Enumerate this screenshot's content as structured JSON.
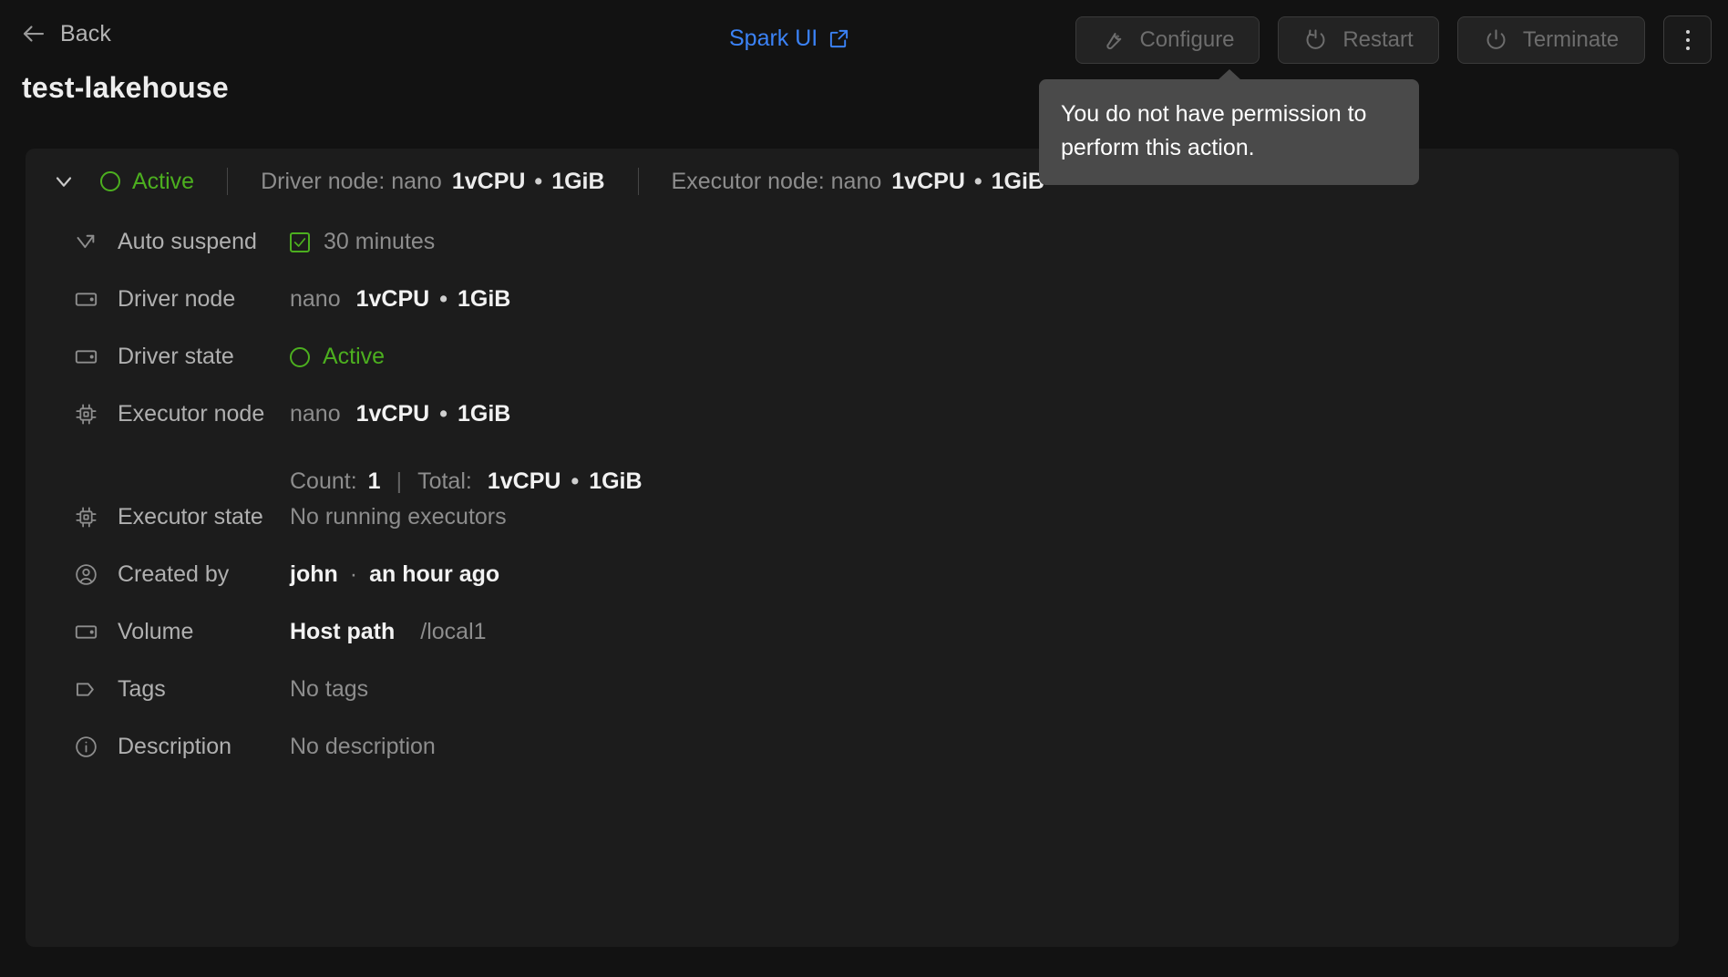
{
  "topbar": {
    "back_label": "Back",
    "back_icon": "arrow-left-icon",
    "spark_link_label": "Spark UI",
    "spark_link_icon": "external-link-icon",
    "buttons": [
      {
        "label": "Configure",
        "icon": "wrench-icon",
        "disabled": true
      },
      {
        "label": "Restart",
        "icon": "restart-power-icon",
        "disabled": true
      },
      {
        "label": "Terminate",
        "icon": "power-icon",
        "disabled": true
      }
    ],
    "kebab_icon": "more-vertical-icon"
  },
  "page_title": "test-lakehouse",
  "tooltip": {
    "text": "You do not have permission to perform this action."
  },
  "summary": {
    "chevron_icon": "chevron-down-icon",
    "status": "Active",
    "status_color": "#4caf1f",
    "driver": {
      "label": "Driver node: nano",
      "cpu": "1vCPU",
      "separator": "•",
      "memory": "1GiB"
    },
    "executor": {
      "label": "Executor node: nano",
      "cpu": "1vCPU",
      "separator": "•",
      "memory": "1GiB"
    }
  },
  "details": {
    "auto_suspend": {
      "icon": "auto-suspend-arrow-icon",
      "label": "Auto suspend",
      "checked": true,
      "value": "30 minutes"
    },
    "driver_node": {
      "icon": "node-box-icon",
      "label": "Driver node",
      "size": "nano",
      "cpu": "1vCPU",
      "separator": "•",
      "memory": "1GiB"
    },
    "driver_state": {
      "icon": "node-box-icon",
      "label": "Driver state",
      "value": "Active",
      "color": "#4caf1f"
    },
    "executor_node": {
      "icon": "cpu-chip-icon",
      "label": "Executor node",
      "size": "nano",
      "cpu": "1vCPU",
      "separator": "•",
      "memory": "1GiB",
      "count_label": "Count:",
      "count_value": "1",
      "pipe": "|",
      "total_label": "Total:",
      "total_cpu": "1vCPU",
      "total_separator": "•",
      "total_memory": "1GiB"
    },
    "executor_state": {
      "icon": "cpu-chip-icon",
      "label": "Executor state",
      "value": "No running executors"
    },
    "created_by": {
      "icon": "user-circle-icon",
      "label": "Created by",
      "user": "john",
      "separator": "·",
      "time": "an hour ago"
    },
    "volume": {
      "icon": "node-box-icon",
      "label": "Volume",
      "type": "Host path",
      "path": "/local1"
    },
    "tags": {
      "icon": "tag-icon",
      "label": "Tags",
      "value": "No tags"
    },
    "description": {
      "icon": "info-circle-icon",
      "label": "Description",
      "value": "No description"
    }
  },
  "colors": {
    "page_bg": "#121212",
    "card_bg": "#1c1c1c",
    "accent_green": "#4caf1f",
    "link_blue": "#3b82f6",
    "tooltip_bg": "#4a4a4a"
  }
}
